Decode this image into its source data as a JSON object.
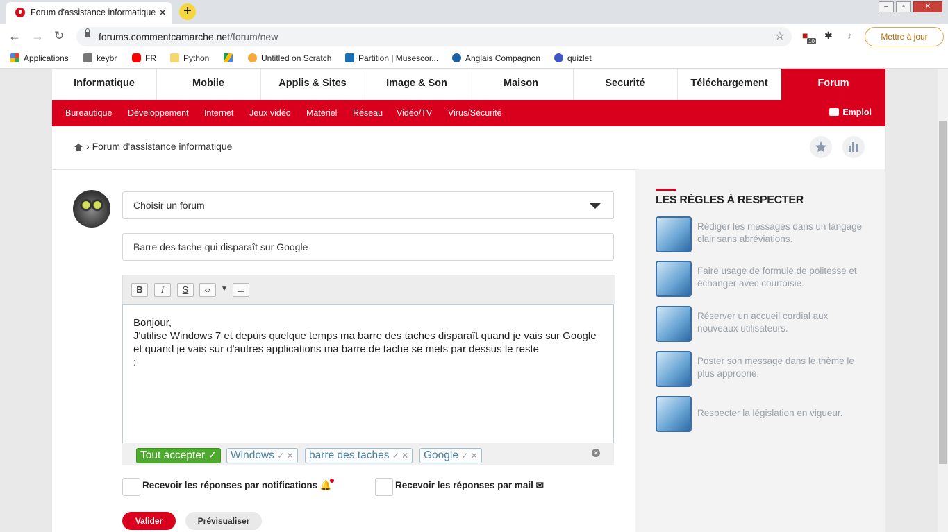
{
  "browser": {
    "tab_title": "Forum d'assistance informatique",
    "url_host": "forums.commentcamarche.net",
    "url_path": "/forum/new",
    "update_button": "Mettre à jour",
    "extension_badge": "10",
    "bookmarks": [
      "Applications",
      "keybr",
      "FR",
      "Python",
      "Untitled on Scratch",
      "Partition | Musescor...",
      "Anglais Compagnon",
      "quizlet"
    ]
  },
  "site": {
    "categories": [
      "Informatique",
      "Mobile",
      "Applis & Sites",
      "Image & Son",
      "Maison",
      "Securité",
      "Téléchargement",
      "Forum"
    ],
    "active_category": "Forum",
    "subnav": [
      "Bureautique",
      "Développement",
      "Internet",
      "Jeux vidéo",
      "Matériel",
      "Réseau",
      "Vidéo/TV",
      "Virus/Sécurité"
    ],
    "emploi": "Emploi",
    "breadcrumb": "Forum d'assistance informatique"
  },
  "form": {
    "forum_select": "Choisir un forum",
    "title_value": "Barre des tache qui disparaît sur Google",
    "toolbar": [
      "B",
      "I",
      "S"
    ],
    "message_lines": [
      "Bonjour,",
      "J'utilise Windows 7 et depuis quelque temps ma barre des taches disparaît quand je vais sur Google et quand je vais sur d'autres applications ma barre de tache se mets par dessus le reste",
      ":"
    ],
    "accept_all": "Tout accepter ✓",
    "tags": [
      "Windows",
      "barre des taches",
      "Google"
    ],
    "notify_label": "Recevoir les réponses par notifications",
    "mail_label": "Recevoir les réponses par mail",
    "submit": "Valider",
    "preview": "Prévisualiser"
  },
  "rules": {
    "title": "LES RÈGLES À RESPECTER",
    "items": [
      "Rédiger les messages dans un langage clair sans abréviations.",
      "Faire usage de formule de politesse et échanger avec courtoisie.",
      "Réserver un accueil cordial aux nouveaux utilisateurs.",
      "Poster son message dans le thème le plus approprié.",
      "Respecter la législation en vigueur."
    ]
  },
  "colors": {
    "brand_red": "#d8001c",
    "tag_green": "#4ea92f",
    "tag_blue": "#4d7fa0"
  }
}
